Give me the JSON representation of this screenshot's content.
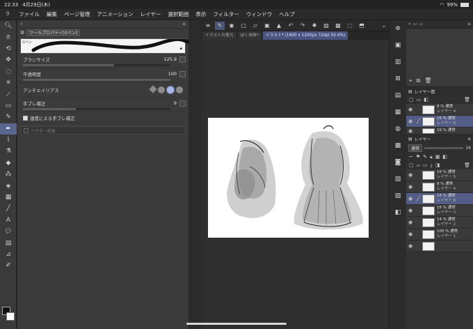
{
  "status": {
    "time": "22:33",
    "date": "4月29日(木)",
    "battery": "99%"
  },
  "menu": [
    "ファイル",
    "編集",
    "ページ管理",
    "アニメーション",
    "レイヤー",
    "選択範囲",
    "表示",
    "フィルター",
    "ウィンドウ",
    "ヘルプ"
  ],
  "tool_property": {
    "title": "ツールプロパティ[Gペン]",
    "tab_label": "Gペン",
    "brush_size": {
      "label": "ブラシサイズ",
      "value": "125.9",
      "fill": 0.62
    },
    "opacity": {
      "label": "不透明度",
      "value": "100",
      "fill": 1.0
    },
    "antialias": {
      "label": "アンチエイリアス"
    },
    "stabilization": {
      "label": "手ブレ補正",
      "value": "9",
      "fill": 0.36
    },
    "speed_stabilization": {
      "label": "速度による手ブレ補正"
    },
    "vector_snap": {
      "label": "ベクター吸着"
    }
  },
  "document_tabs": [
    {
      "label": "イラスト3(復元",
      "active": false
    },
    {
      "label": "ぼく地球*",
      "active": false
    },
    {
      "label": "イラスト* (1600 x 1200px 72dpi 50.4%)",
      "active": true
    }
  ],
  "layer_panel": {
    "title": "レイヤー",
    "top_title": "レイヤー数",
    "blend_mode": "通常",
    "opacity_value": "16",
    "top_layers": [
      {
        "pct": "8 %  通常",
        "name": "レイヤー 4",
        "selected": false
      },
      {
        "pct": "16 %  通常",
        "name": "レイヤー 6",
        "selected": true
      },
      {
        "pct": "16 %  通常",
        "name": "",
        "selected": false
      }
    ],
    "layers": [
      {
        "pct": "16 %  通常",
        "name": "レイヤー 5",
        "selected": false
      },
      {
        "pct": "8 %  通常",
        "name": "レイヤー 4",
        "selected": false
      },
      {
        "pct": "16 %  通常",
        "name": "レイヤー 6",
        "selected": true
      },
      {
        "pct": "16 %  通常",
        "name": "レイヤー 3",
        "selected": false
      },
      {
        "pct": "14 %  通常",
        "name": "レイヤー 2",
        "selected": false
      },
      {
        "pct": "100 %  通常",
        "name": "レイヤー 1",
        "selected": false
      },
      {
        "pct": "",
        "name": "",
        "selected": false
      }
    ]
  },
  "colors": {
    "accent": "#5a6590",
    "selected_layer": "#535d86"
  }
}
